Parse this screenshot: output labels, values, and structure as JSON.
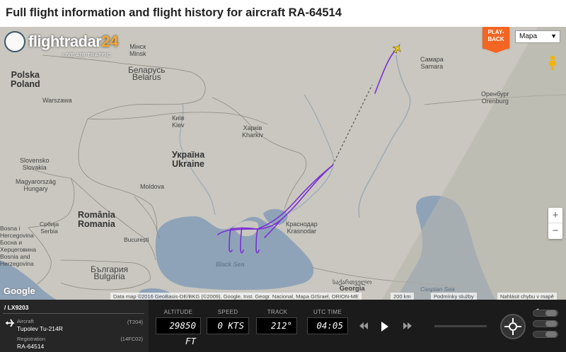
{
  "page_title": "Full flight information and flight history for aircraft RA-64514",
  "logo": {
    "text": "flightradar",
    "number": "24",
    "subtitle": "LIVE AIR TRAFFIC"
  },
  "map_controls": {
    "playback_line1": "PLAY-",
    "playback_line2": "BACK",
    "map_type": "Mapa",
    "zoom_in": "+",
    "zoom_out": "−"
  },
  "map_labels": {
    "minsk_cyr": "Мінск",
    "minsk": "Minsk",
    "belarus_cyr": "Беларусь",
    "belarus": "Belarus",
    "poland1": "Polska",
    "poland2": "Poland",
    "warsaw": "Warszawa",
    "kyiv_cyr": "Київ",
    "kyiv": "Kiev",
    "kharkiv_cyr": "Харків",
    "kharkiv": "Kharkiv",
    "ukraine_cyr": "Україна",
    "ukraine": "Ukraine",
    "slovakia": "Slovensko",
    "slovakia_en": "Slovakia",
    "hungary": "Magyarország",
    "hungary_en": "Hungary",
    "moldova": "Moldova",
    "romania1": "România",
    "romania2": "Romania",
    "bucharest": "București",
    "serbia1": "Србија",
    "serbia2": "Serbia",
    "bosnia1": "Bosna i",
    "bosnia2": "Hercegovina",
    "bosnia3": "Босна и",
    "bosnia4": "Херцеговина",
    "bosnia5": "Bosnia and",
    "bosnia6": "Herzegovina",
    "bulgaria_cyr": "България",
    "bulgaria": "Bulgaria",
    "black_sea": "Black Sea",
    "krasnodar_cyr": "Краснодар",
    "krasnodar": "Krasnodar",
    "samara_cyr": "Самара",
    "samara": "Samara",
    "orenburg_cyr": "Оренбург",
    "orenburg": "Orenburg",
    "georgia_geo": "საქართველო",
    "georgia": "Georgia",
    "caspian": "Caspian Sea"
  },
  "map_footer": {
    "google": "Google",
    "attribution": "Data map ©2016 GeoBasis-DE/BKG (©2009), Google, Inst. Geogr. Nacional, Mapa GISrael, ORION-ME",
    "scale": "200 km",
    "terms": "Podmínky služby",
    "report": "Nahlásit chybu v mapě"
  },
  "flight": {
    "callsign": "/ LX9203",
    "aircraft_label": "Aircraft",
    "aircraft_code": "(T204)",
    "aircraft_model": "Tupolev Tu-214R",
    "registration_label": "Registration",
    "registration_code": "(14FC02)",
    "registration": "RA-64514"
  },
  "gauges": {
    "altitude_label": "ALTITUDE",
    "altitude": "29850 FT",
    "speed_label": "SPEED",
    "speed": "0 KTS",
    "track_label": "TRACK",
    "track": "212°",
    "time_label": "UTC TIME",
    "time": "04:05"
  },
  "colors": {
    "track": "#7a2fd6",
    "playback": "#f26522",
    "bar": "#1b1b1b",
    "map_land": "#c9c7bf",
    "map_sea": "#8fa3b8"
  },
  "icons": [
    "plane-icon",
    "rewind-icon",
    "play-icon",
    "fast-forward-icon",
    "crosshair-icon",
    "pegman-icon",
    "moon-icon"
  ]
}
